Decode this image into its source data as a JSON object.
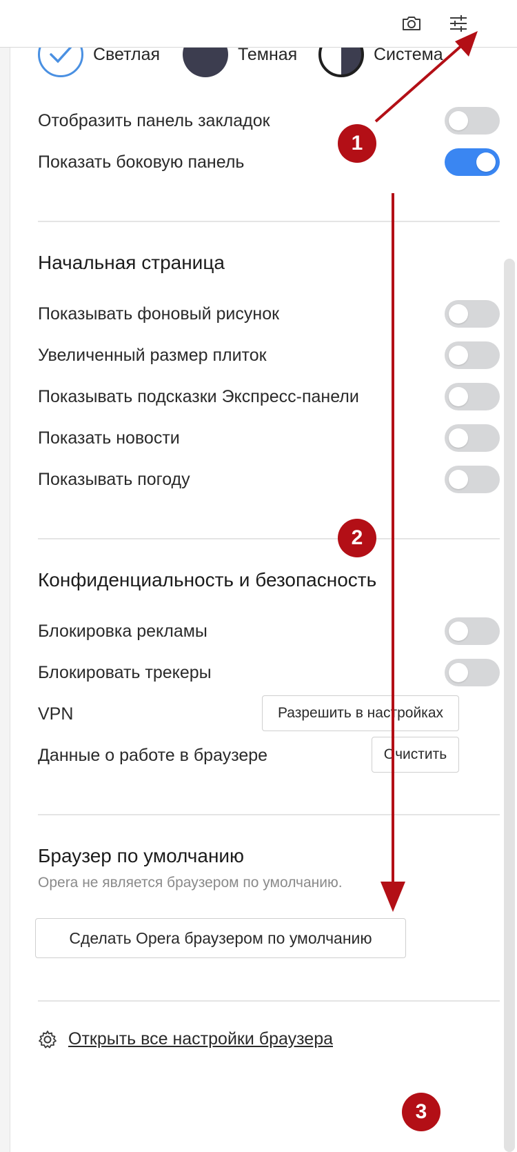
{
  "toolbar": {
    "icons": [
      "camera-icon",
      "sliders-icon"
    ]
  },
  "theme": {
    "options": [
      {
        "label": "Светлая",
        "selected": true
      },
      {
        "label": "Темная",
        "selected": false
      },
      {
        "label": "Система",
        "selected": false
      }
    ]
  },
  "appearance": {
    "rows": [
      {
        "label": "Отобразить панель закладок",
        "on": false
      },
      {
        "label": "Показать боковую панель",
        "on": true
      }
    ]
  },
  "start_page": {
    "title": "Начальная страница",
    "rows": [
      {
        "label": "Показывать фоновый рисунок",
        "on": false
      },
      {
        "label": "Увеличенный размер плиток",
        "on": false
      },
      {
        "label": "Показывать подсказки Экспресс-панели",
        "on": false
      },
      {
        "label": "Показать новости",
        "on": false
      },
      {
        "label": "Показывать погоду",
        "on": false
      }
    ]
  },
  "privacy": {
    "title": "Конфиденциальность и безопасность",
    "rows": [
      {
        "label": "Блокировка рекламы",
        "on": false
      },
      {
        "label": "Блокировать трекеры",
        "on": false
      }
    ],
    "vpn_label": "VPN",
    "vpn_button": "Разрешить в настройках",
    "browsing_data_label": "Данные о работе в браузере",
    "clear_button": "Очистить"
  },
  "default_browser": {
    "title": "Браузер по умолчанию",
    "status": "Opera не является браузером по умолчанию.",
    "make_default_button": "Сделать Opera браузером по умолчанию"
  },
  "footer": {
    "open_settings_link": "Открыть все настройки браузера"
  },
  "annotations": {
    "markers": [
      "1",
      "2",
      "3"
    ],
    "color": "#b30f16"
  },
  "colors": {
    "accent": "#3a86f2",
    "toggle_off": "#d6d7d9",
    "dark_theme": "#3c3d4f"
  }
}
